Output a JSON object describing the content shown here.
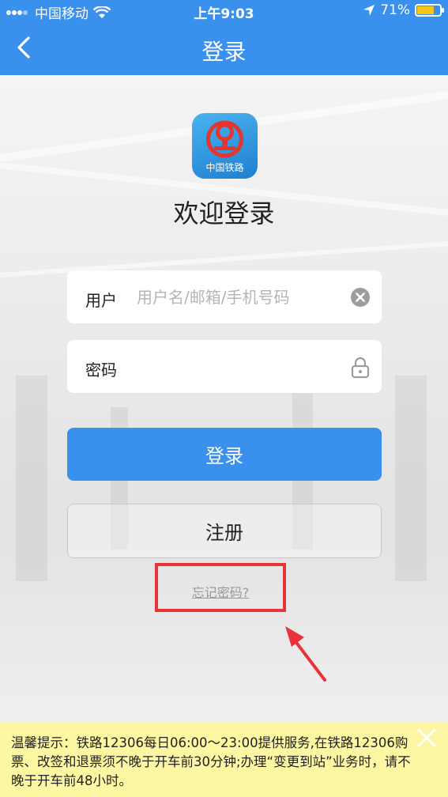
{
  "status_bar": {
    "carrier": "中国移动",
    "time": "上午9:03",
    "battery": "71%",
    "battery_level": 0.71,
    "icons": [
      "signal-icon",
      "wifi-icon",
      "location-arrow-icon",
      "battery-icon"
    ]
  },
  "nav": {
    "title": "登录",
    "back_icon": "chevron-left-icon"
  },
  "logo": {
    "text": "中国铁路",
    "icon": "china-railway-logo-icon"
  },
  "welcome": "欢迎登录",
  "form": {
    "user_label": "用户",
    "user_placeholder": "用户名/邮箱/手机号码",
    "user_value": "",
    "user_clear_icon": "clear-circle-icon",
    "password_label": "密码",
    "password_value": "",
    "password_icon": "lock-icon"
  },
  "buttons": {
    "login": "登录",
    "register": "注册"
  },
  "forgot_password": "忘记密码?",
  "annotation": {
    "highlight_color": "#e8333a",
    "arrow_color": "#e8333a"
  },
  "notice": {
    "text": "温馨提示：铁路12306每日06:00～23:00提供服务,在铁路12306购票、改签和退票须不晚于开车前30分钟;办理“变更到站”业务时，请不晚于开车前48小时。",
    "close_icon": "close-icon"
  },
  "colors": {
    "accent": "#3a91ed",
    "notice_bg": "#fdf6a3"
  }
}
